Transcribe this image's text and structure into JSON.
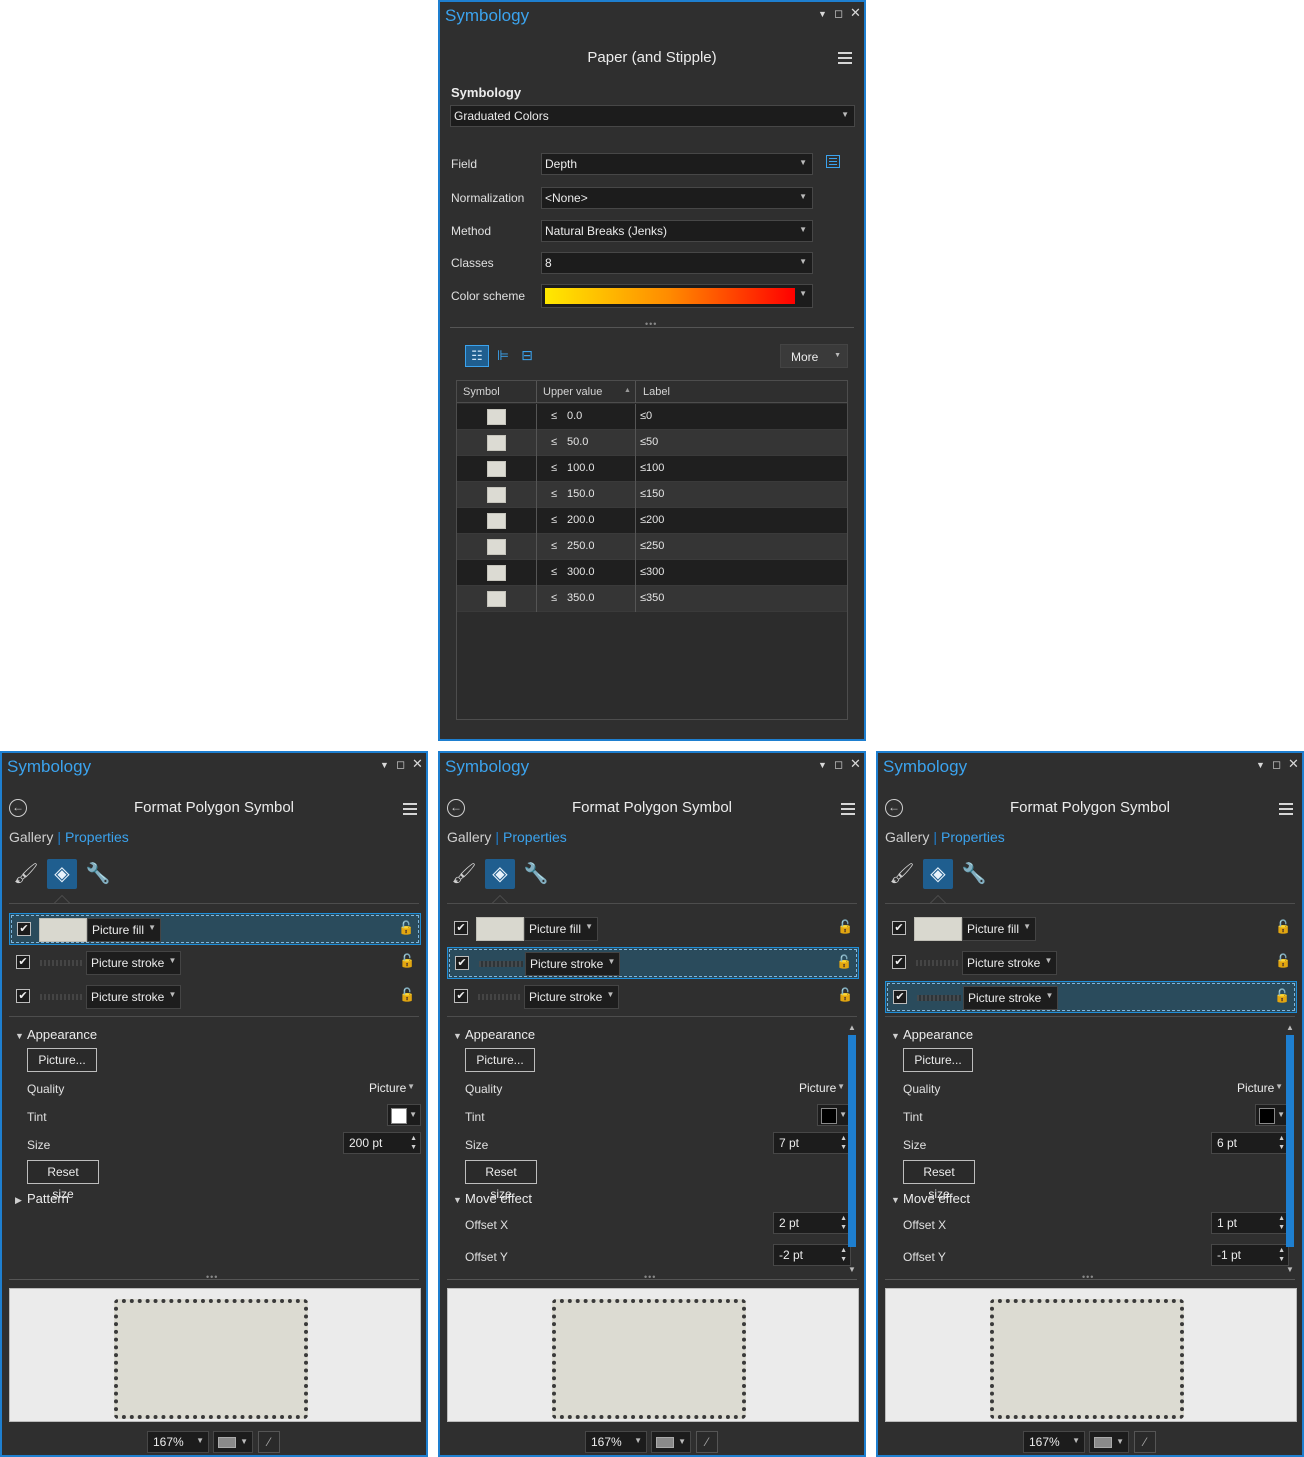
{
  "top_pane": {
    "window_title": "Symbology",
    "layer_name": "Paper (and Stipple)",
    "symbology_label": "Symbology",
    "symbology_value": "Graduated Colors",
    "field_label": "Field",
    "field_value": "Depth",
    "normalization_label": "Normalization",
    "normalization_value": "<None>",
    "method_label": "Method",
    "method_value": "Natural Breaks (Jenks)",
    "classes_label": "Classes",
    "classes_value": "8",
    "color_scheme_label": "Color scheme",
    "color_scheme_colors": [
      "#ffe900",
      "#ff8a00",
      "#ff0000"
    ],
    "more_label": "More",
    "table": {
      "headers": [
        "Symbol",
        "Upper value",
        "Label"
      ],
      "leq": "≤",
      "rows": [
        {
          "upper": "0.0",
          "label": "≤0"
        },
        {
          "upper": "50.0",
          "label": "≤50"
        },
        {
          "upper": "100.0",
          "label": "≤100"
        },
        {
          "upper": "150.0",
          "label": "≤150"
        },
        {
          "upper": "200.0",
          "label": "≤200"
        },
        {
          "upper": "250.0",
          "label": "≤250"
        },
        {
          "upper": "300.0",
          "label": "≤300"
        },
        {
          "upper": "350.0",
          "label": "≤350"
        }
      ]
    }
  },
  "panes": [
    {
      "window_title": "Symbology",
      "heading": "Format Polygon Symbol",
      "tab_gallery": "Gallery",
      "tab_properties": "Properties",
      "layers": [
        {
          "name": "Picture fill",
          "kind": "fill"
        },
        {
          "name": "Picture stroke",
          "kind": "stroke"
        },
        {
          "name": "Picture stroke",
          "kind": "stroke"
        }
      ],
      "selected_layer": 0,
      "appearance_label": "Appearance",
      "picture_button": "Picture...",
      "quality_label": "Quality",
      "quality_value": "Picture",
      "tint_label": "Tint",
      "tint_color": "#ffffff",
      "size_label": "Size",
      "size_value": "200 pt",
      "reset_size": "Reset size",
      "pattern_label": "Pattern",
      "zoom": "167%"
    },
    {
      "window_title": "Symbology",
      "heading": "Format Polygon Symbol",
      "tab_gallery": "Gallery",
      "tab_properties": "Properties",
      "layers": [
        {
          "name": "Picture fill",
          "kind": "fill"
        },
        {
          "name": "Picture stroke",
          "kind": "stroke"
        },
        {
          "name": "Picture stroke",
          "kind": "stroke"
        }
      ],
      "selected_layer": 1,
      "appearance_label": "Appearance",
      "picture_button": "Picture...",
      "quality_label": "Quality",
      "quality_value": "Picture",
      "tint_label": "Tint",
      "tint_color": "#000000",
      "size_label": "Size",
      "size_value": "7 pt",
      "reset_size": "Reset size",
      "move_effect_label": "Move effect",
      "offset_x_label": "Offset X",
      "offset_x_value": "2 pt",
      "offset_y_label": "Offset Y",
      "offset_y_value": "-2 pt",
      "zoom": "167%"
    },
    {
      "window_title": "Symbology",
      "heading": "Format Polygon Symbol",
      "tab_gallery": "Gallery",
      "tab_properties": "Properties",
      "layers": [
        {
          "name": "Picture fill",
          "kind": "fill"
        },
        {
          "name": "Picture stroke",
          "kind": "stroke"
        },
        {
          "name": "Picture stroke",
          "kind": "stroke"
        }
      ],
      "selected_layer": 2,
      "appearance_label": "Appearance",
      "picture_button": "Picture...",
      "quality_label": "Quality",
      "quality_value": "Picture",
      "tint_label": "Tint",
      "tint_color": "#000000",
      "size_label": "Size",
      "size_value": "6 pt",
      "reset_size": "Reset size",
      "move_effect_label": "Move effect",
      "offset_x_label": "Offset X",
      "offset_x_value": "1 pt",
      "offset_y_label": "Offset Y",
      "offset_y_value": "-1 pt",
      "zoom": "167%"
    }
  ],
  "icons": {
    "pin": "pin-icon",
    "maximize": "maximize-icon",
    "close": "close-icon",
    "menu": "hamburger-menu-icon",
    "back": "back-arrow-icon",
    "brush": "paintbrush-icon",
    "layers": "layers-icon",
    "wrench": "wrench-icon",
    "lock": "symbol-lock-icon",
    "field_list": "field-list-icon"
  }
}
